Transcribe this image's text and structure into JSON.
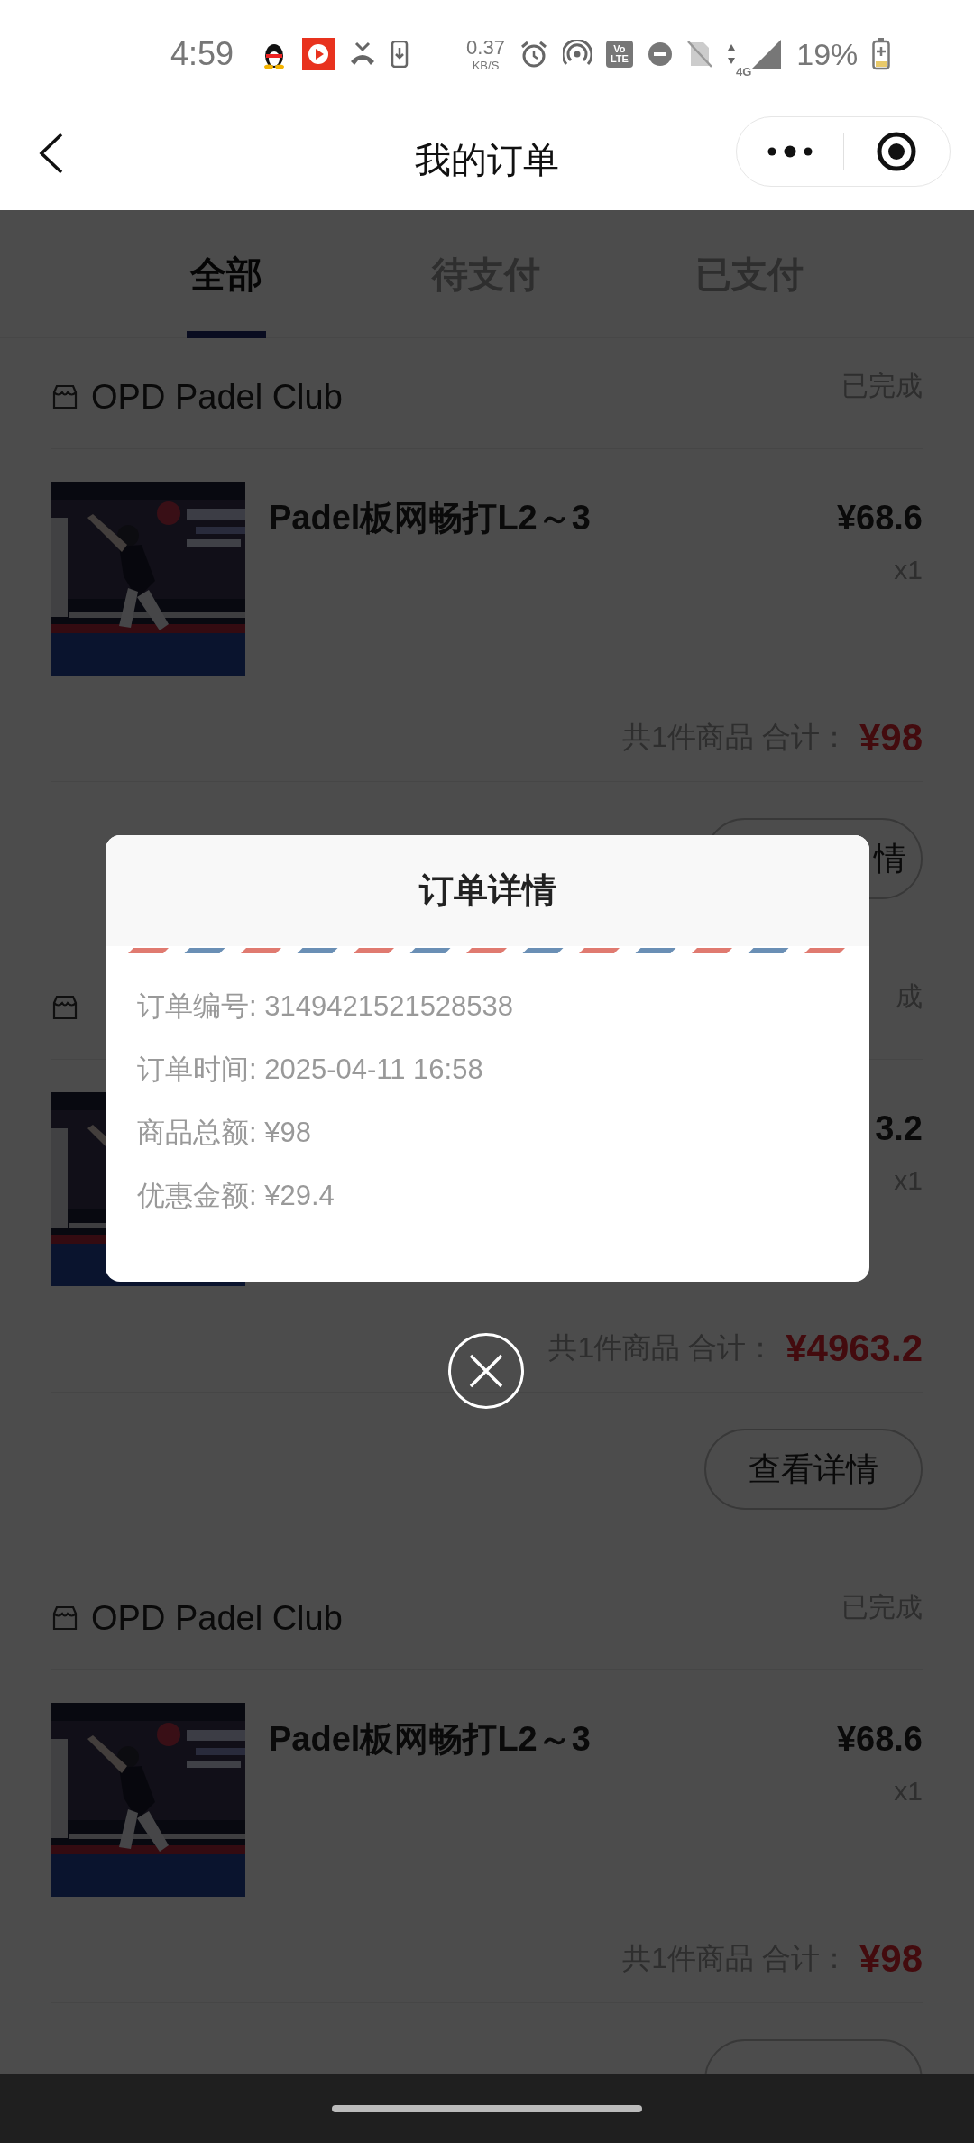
{
  "status_bar": {
    "time": "4:59",
    "net_speed": "0.37",
    "net_unit": "KB/S",
    "volte": [
      "Vo",
      "LTE"
    ],
    "network": "4G",
    "battery": "19%"
  },
  "header": {
    "title": "我的订单"
  },
  "tabs": [
    {
      "label": "全部",
      "selected": true
    },
    {
      "label": "待支付",
      "selected": false
    },
    {
      "label": "已支付",
      "selected": false
    }
  ],
  "orders": [
    {
      "store": "OPD Padel Club",
      "status": "已完成",
      "product": {
        "kind": "picture",
        "title": "Padel板网畅打L2～3",
        "price": "¥68.6",
        "quantity": "x1"
      },
      "summary": "共1件商品 合计：",
      "total": "¥98",
      "button": "情"
    },
    {
      "status": "成",
      "product": {
        "kind": "picture",
        "price": "3.2",
        "quantity": "x1"
      },
      "summary": "共1件商品 合计：",
      "total": "¥4963.2",
      "button": "查看详情"
    },
    {
      "store": "OPD Padel Club",
      "status": "已完成",
      "product": {
        "kind": "picture",
        "title": "Padel板网畅打L2～3",
        "price": "¥68.6",
        "quantity": "x1"
      },
      "summary": "共1件商品 合计：",
      "total": "¥98"
    }
  ],
  "modal": {
    "title": "订单详情",
    "rows": [
      "订单编号: 3149421521528538",
      "订单时间: 2025-04-11 16:58",
      "商品总额: ¥98",
      "优惠金额: ¥29.4"
    ]
  }
}
